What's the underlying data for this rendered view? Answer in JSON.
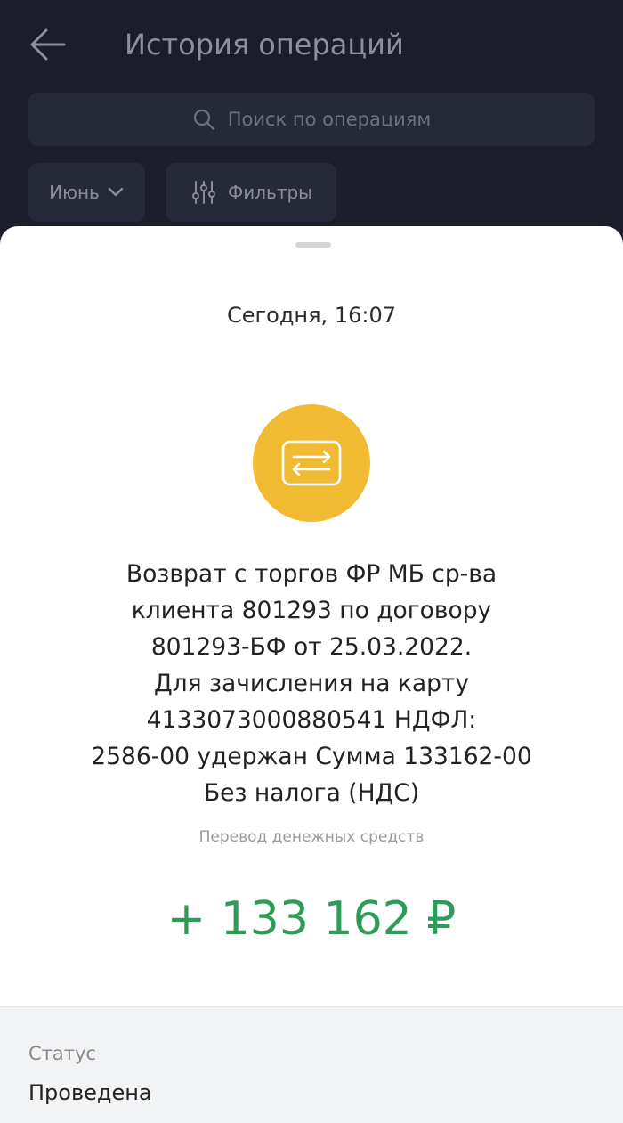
{
  "header": {
    "title": "История операций",
    "search_placeholder": "Поиск по операциям",
    "month_filter": "Июнь",
    "filters_label": "Фильтры"
  },
  "operation": {
    "date": "Сегодня, 16:07",
    "description_lines": [
      "Возврат с торгов ФР МБ ср-ва",
      "клиента 801293 по договору",
      "801293-БФ от 25.03.2022.",
      "Для зачисления на карту",
      "4133073000880541 НДФЛ:",
      "2586-00 удержан Сумма 133162-00",
      "Без налога (НДС)"
    ],
    "category": "Перевод денежных средств",
    "amount": "+ 133 162 ₽",
    "status_label": "Статус",
    "status_value": "Проведена"
  },
  "colors": {
    "header_bg": "#1b1d2a",
    "icon_bg": "#f0bb32",
    "amount_color": "#2e9b58"
  },
  "icons": {
    "back": "arrow-left-icon",
    "search": "search-icon",
    "chevron": "chevron-down-icon",
    "filters": "sliders-icon",
    "operation": "transfer-arrows-icon"
  }
}
